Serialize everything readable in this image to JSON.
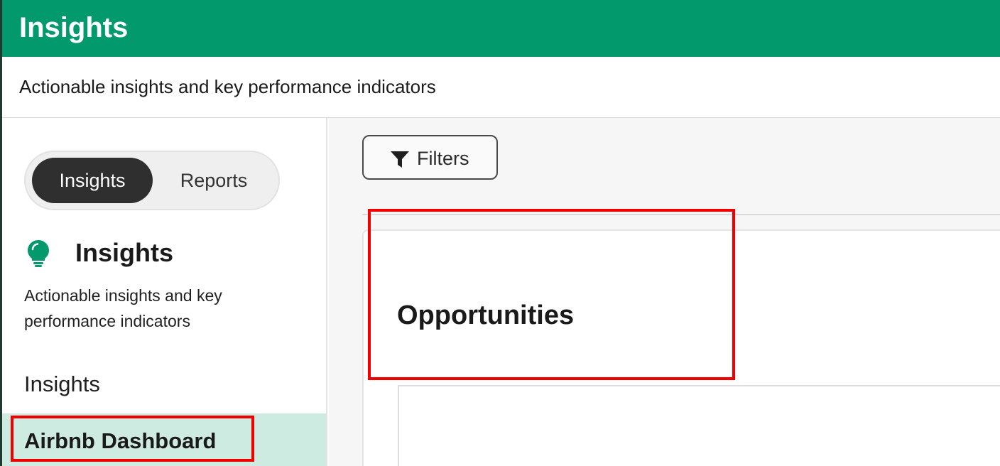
{
  "header": {
    "title": "Insights",
    "subtitle": "Actionable insights and key performance indicators"
  },
  "sidebar": {
    "toggle": {
      "options": [
        "Insights",
        "Reports"
      ],
      "selected": "Insights"
    },
    "panel": {
      "icon": "lightbulb-icon",
      "title": "Insights",
      "description": "Actionable insights and key performance indicators"
    },
    "section_heading": "Insights",
    "items": [
      {
        "label": "Airbnb Dashboard",
        "selected": true
      }
    ]
  },
  "main": {
    "filters_button": {
      "label": "Filters",
      "icon": "filter-icon"
    },
    "card": {
      "title": "Opportunities"
    }
  },
  "colors": {
    "brand": "#029a6d",
    "selected_item_bg": "#cdebe1",
    "highlight": "#f20000",
    "toggle_active": "#2f2f2f"
  }
}
